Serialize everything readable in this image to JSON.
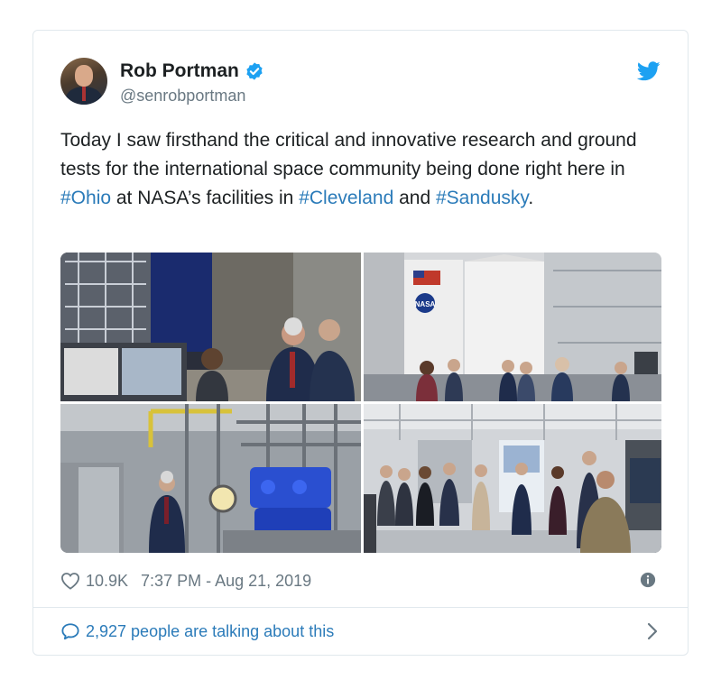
{
  "tweet": {
    "author_name": "Rob Portman",
    "author_handle": "@senrobportman",
    "text_parts": [
      "Today I saw firsthand the critical and innovative research and ground tests for the international space community being done right here in ",
      "#Ohio",
      " at NASA’s facilities in ",
      "#Cleveland",
      " and ",
      "#Sandusky",
      "."
    ],
    "likes": "10.9K",
    "timestamp": "7:37 PM - Aug 21, 2019",
    "talking": "2,927 people are talking about this"
  },
  "icons": {
    "verified": "verified-badge-icon",
    "brand": "twitter-bird-icon",
    "like": "heart-icon",
    "info": "info-icon",
    "reply": "speech-bubble-icon",
    "more": "chevron-right-icon"
  },
  "colors": {
    "link": "#2b7bb9",
    "brand": "#1da1f2",
    "muted": "#697882",
    "text": "#1c2022",
    "border": "#e1e8ed"
  },
  "banner_text": "NASA"
}
